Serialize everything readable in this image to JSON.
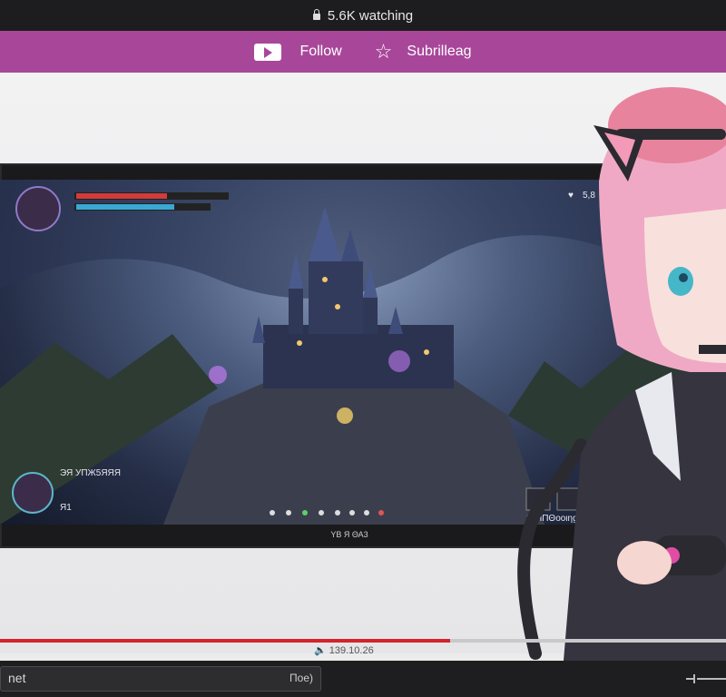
{
  "topbar": {
    "viewers": "5.6K watching"
  },
  "nav": {
    "follow_label": "Follow",
    "subscribe_label": "Subrilleag"
  },
  "game_hud": {
    "top_right": "5,8",
    "player_name": "ЭЯ УΠЖ5ЯЯЯ",
    "player_stat": "Я1",
    "inventory_label": "Э ЯΠΘοοιηg",
    "caption": "YB Я ΘΑ3"
  },
  "player": {
    "progress_percent": 62,
    "time_text": "139.10.26"
  },
  "chat": {
    "input_text": "net",
    "send_label": "Πoe)"
  },
  "colors": {
    "accent": "#a8479a",
    "progress": "#d4242a"
  }
}
